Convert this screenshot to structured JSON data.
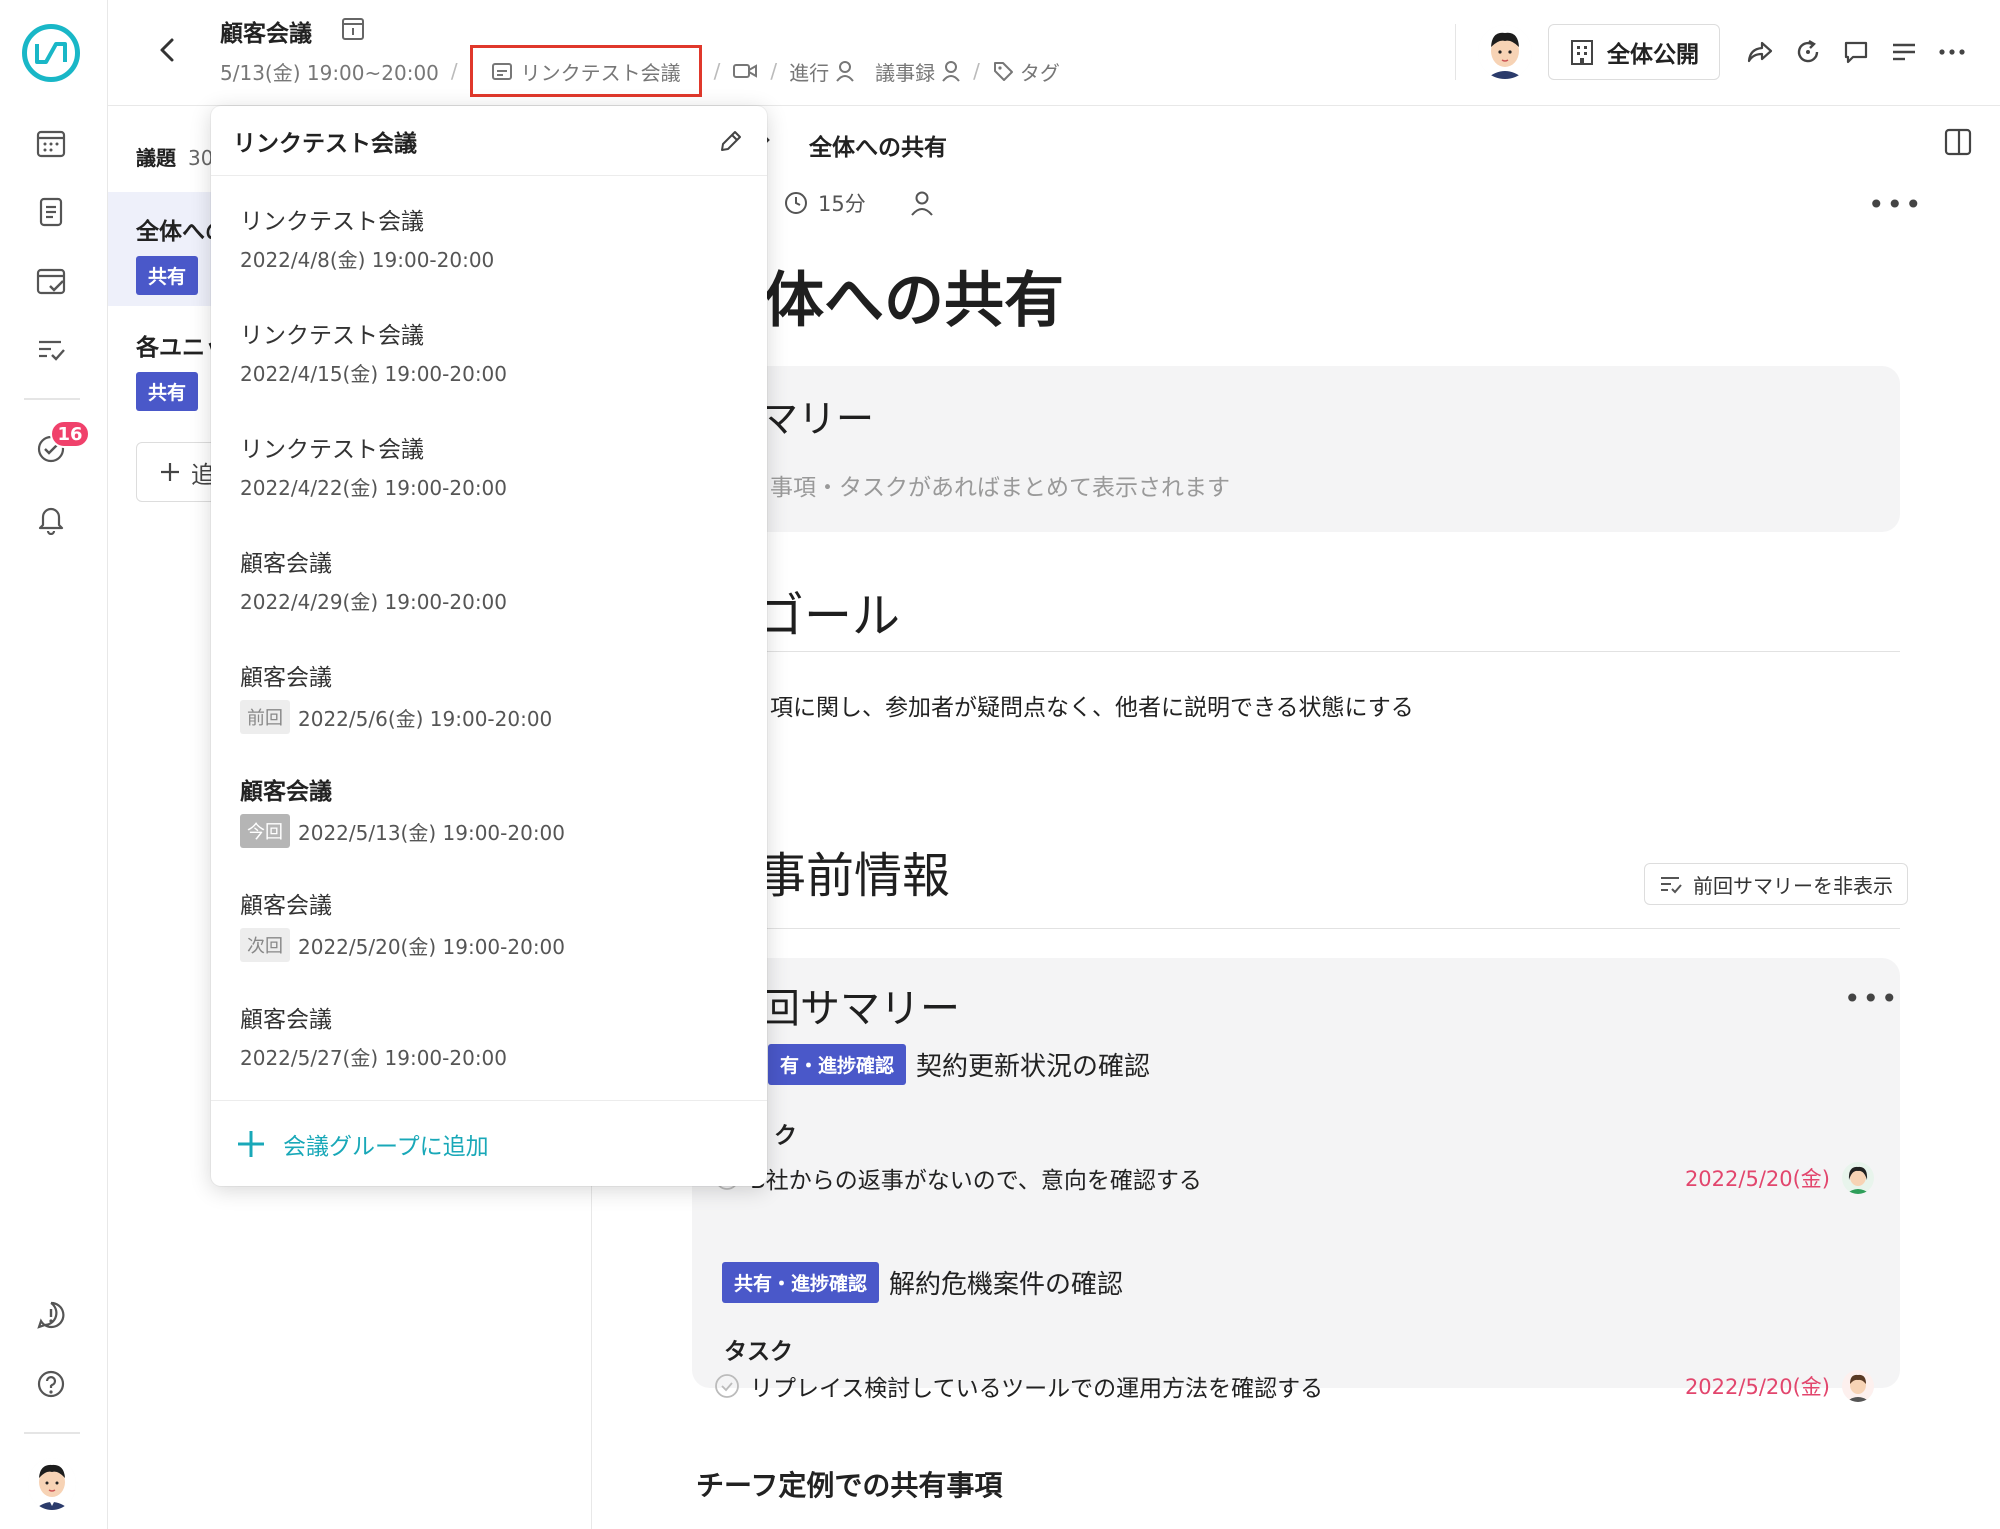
{
  "rail": {
    "badge_count": "16",
    "icons": [
      "logo-icon",
      "calendar-icon",
      "document-icon",
      "calendar-check-icon",
      "task-list-icon",
      "task-check-icon",
      "bell-icon",
      "alert-icon",
      "help-icon"
    ]
  },
  "header": {
    "title": "顧客会議",
    "datetime": "5/13(金) 19:00~20:00",
    "group_link": "リンクテスト会議",
    "facilitator_label": "進行",
    "minutes_label": "議事録",
    "tag_label": "タグ",
    "visibility_label": "全体公開"
  },
  "agenda": {
    "heading": "議題",
    "count": "30",
    "items": [
      {
        "title": "全体への",
        "tag": "共有"
      },
      {
        "title": "各ユニッ",
        "tag": "共有"
      }
    ],
    "add_label": "追"
  },
  "main": {
    "breadcrumb": "全体への共有",
    "duration": "15分",
    "title": "体への共有",
    "summary_heading": "マリー",
    "summary_placeholder": "事項・タスクがあればまとめて表示されます",
    "goal_heading": "ゴール",
    "goal_text": "項に関し、参加者が疑問点なく、他者に説明できる状態にする",
    "preinfo_heading": "事前情報",
    "hide_summary_label": "前回サマリーを非表示",
    "prev_summary_heading": "回サマリー",
    "summaries": [
      {
        "tag": "有・進捗確認",
        "title": "契約更新状況の確認",
        "task_label": "ク",
        "task_text": "B社からの返事がないので、意向を確認する",
        "due": "2022/5/20(金)"
      },
      {
        "tag": "共有・進捗確認",
        "title": "解約危機案件の確認",
        "task_label": "タスク",
        "task_text": "リプレイス検討しているツールでの運用方法を確認する",
        "due": "2022/5/20(金)"
      }
    ],
    "bottom_section": "チーフ定例での共有事項"
  },
  "popover": {
    "title": "リンクテスト会議",
    "items": [
      {
        "name": "リンクテスト会議",
        "date": "2022/4/8(金) 19:00-20:00",
        "chip": ""
      },
      {
        "name": "リンクテスト会議",
        "date": "2022/4/15(金) 19:00-20:00",
        "chip": ""
      },
      {
        "name": "リンクテスト会議",
        "date": "2022/4/22(金) 19:00-20:00",
        "chip": ""
      },
      {
        "name": "顧客会議",
        "date": "2022/4/29(金) 19:00-20:00",
        "chip": ""
      },
      {
        "name": "顧客会議",
        "date": "2022/5/6(金) 19:00-20:00",
        "chip": "前回"
      },
      {
        "name": "顧客会議",
        "date": "2022/5/13(金) 19:00-20:00",
        "chip": "今回"
      },
      {
        "name": "顧客会議",
        "date": "2022/5/20(金) 19:00-20:00",
        "chip": "次回"
      },
      {
        "name": "顧客会議",
        "date": "2022/5/27(金) 19:00-20:00",
        "chip": ""
      }
    ],
    "add_label": "会議グループに追加"
  },
  "colors": {
    "brand": "#19b7c7",
    "tag": "#4a58c9",
    "due": "#e2466d",
    "highlight": "#e0382b"
  }
}
